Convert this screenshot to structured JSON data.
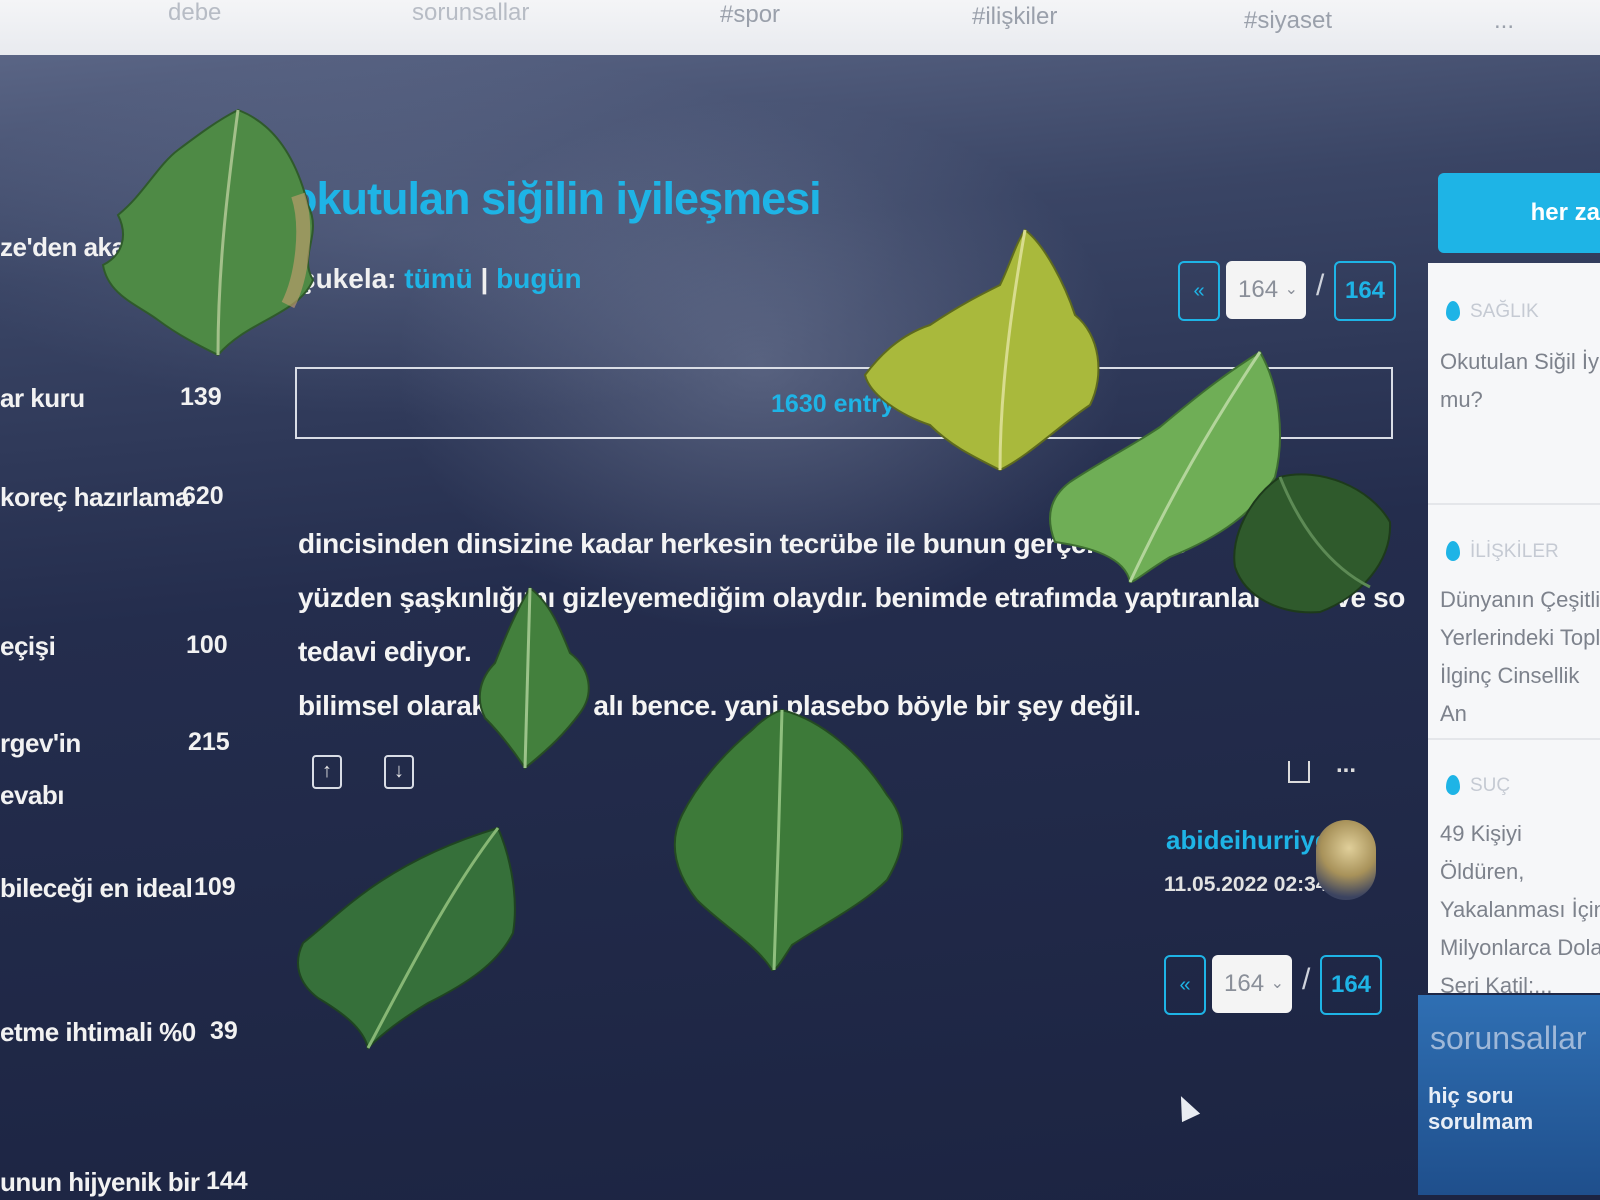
{
  "topnav": {
    "items": [
      "debe",
      "sorunsallar",
      "#spor",
      "#ilişkiler",
      "#siyaset",
      "..."
    ]
  },
  "left_list": [
    {
      "label": "ze'den akan",
      "count": ""
    },
    {
      "label": "ar kuru",
      "count": "139"
    },
    {
      "label": "koreç hazırlama",
      "count": "620"
    },
    {
      "label": "eçişi",
      "count": "100"
    },
    {
      "label": "rgev'in",
      "count": "215"
    },
    {
      "label": "evabı",
      "count": ""
    },
    {
      "label": "bileceği en ideal",
      "count": "109"
    },
    {
      "label": "etme ihtimali %0",
      "count": "39"
    },
    {
      "label": "unun hijyenik bir",
      "count": "144"
    }
  ],
  "topic": {
    "title": "okutulan siğilin iyileşmesi",
    "filter_prefix": "şukela:",
    "filter_all": "tümü",
    "filter_sep": "|",
    "filter_today": "bugün"
  },
  "pager": {
    "prev": "«",
    "current": "164",
    "sep": "/",
    "total": "164"
  },
  "entry_bar": "1630 entry d",
  "entry": {
    "lines": [
      "dincisinden dinsizine kadar herkesin tecrübe ile bunun gerçekten işe          söyled",
      "yüzden şaşkınlığımı gizleyemediğim olaydır. benimde etrafımda yaptıranlar oldu ve so",
      "tedavi ediyor.",
      "bilimsel olarak ar          alı bence. yani plasebo böyle bir şey değil."
    ],
    "author": "abideihurriyet",
    "date": "11.05.2022 02:34",
    "more": "..."
  },
  "sidebar": {
    "header": "her za",
    "items": [
      {
        "category": "SAĞLIK",
        "text": [
          "Okutulan Siğil İy",
          "mu?"
        ]
      },
      {
        "category": "İLİŞKİLER",
        "text": [
          "Dünyanın Çeşitli",
          "Yerlerindeki Topl",
          "İlginç Cinsellik An"
        ]
      },
      {
        "category": "SUÇ",
        "text": [
          "49 Kişiyi Öldüren,",
          "Yakalanması İçin",
          "Milyonlarca Dolar",
          "Seri Katil:..."
        ]
      }
    ],
    "bottom_title": "sorunsallar",
    "bottom_sub": "hiç soru sorulmam"
  },
  "colors": {
    "accent": "#1eb4e6",
    "leaf_green": "#3f7a3a",
    "leaf_yellow": "#a8b83a"
  }
}
